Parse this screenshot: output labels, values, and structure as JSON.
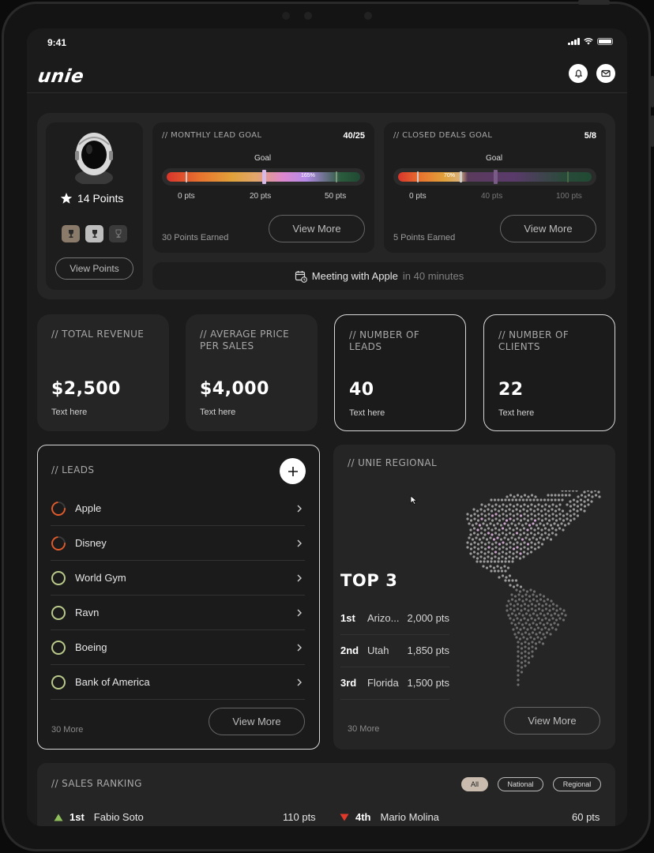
{
  "status": {
    "time": "9:41"
  },
  "brand": {
    "logo": "unie"
  },
  "header_icons": [
    "bell-icon",
    "mail-icon"
  ],
  "profile": {
    "points_label": "14 Points",
    "trophies": [
      "trophy-gold-icon",
      "trophy-silver-icon",
      "trophy-locked-icon"
    ],
    "button": "View Points"
  },
  "goals": [
    {
      "title": "// MONTHLY LEAD GOAL",
      "count": "40/25",
      "marker_label": "Goal",
      "percent_label": "165%",
      "progress": 1.65,
      "scale": [
        "0 pts",
        "20 pts",
        "50 pts"
      ],
      "earned": "30 Points Earned",
      "button": "View More"
    },
    {
      "title": "// CLOSED DEALS GOAL",
      "count": "5/8",
      "marker_label": "Goal",
      "percent_label": "70%",
      "progress": 0.7,
      "scale": [
        "0 pts",
        "40 pts",
        "100 pts"
      ],
      "earned": "5 Points Earned",
      "button": "View More"
    }
  ],
  "meeting": {
    "text": "Meeting with Apple",
    "time": "in 40 minutes"
  },
  "stats": [
    {
      "title": "// TOTAL REVENUE",
      "value": "$2,500",
      "sub": "Text here"
    },
    {
      "title": "// AVERAGE PRICE PER SALES",
      "value": "$4,000",
      "sub": "Text here"
    },
    {
      "title": "// NUMBER OF LEADS",
      "value": "40",
      "sub": "Text here"
    },
    {
      "title": "// NUMBER OF CLIENTS",
      "value": "22",
      "sub": "Text here"
    }
  ],
  "leads": {
    "title": "// LEADS",
    "items": [
      {
        "name": "Apple",
        "status": "in-progress"
      },
      {
        "name": "Disney",
        "status": "in-progress"
      },
      {
        "name": "World Gym",
        "status": "new"
      },
      {
        "name": "Ravn",
        "status": "new"
      },
      {
        "name": "Boeing",
        "status": "new"
      },
      {
        "name": "Bank of America",
        "status": "new"
      }
    ],
    "more": "30 More",
    "button": "View More"
  },
  "regional": {
    "title": "// UNIE REGIONAL",
    "heading": "TOP 3",
    "rows": [
      {
        "rank": "1st",
        "region": "Arizo...",
        "points": "2,000 pts"
      },
      {
        "rank": "2nd",
        "region": "Utah",
        "points": "1,850 pts"
      },
      {
        "rank": "3rd",
        "region": "Florida",
        "points": "1,500 pts"
      }
    ],
    "more": "30 More",
    "button": "View More"
  },
  "ranking": {
    "title": "// SALES RANKING",
    "filters": [
      "All",
      "National",
      "Regional"
    ],
    "active_filter": "All",
    "rows": [
      {
        "rank": "1st",
        "name": "Fabio Soto",
        "points": "110 pts",
        "trend": "up"
      },
      {
        "rank": "4th",
        "name": "Mario Molina",
        "points": "60 pts",
        "trend": "down"
      }
    ]
  },
  "colors": {
    "up": "#8fbf5a",
    "down": "#e0392b",
    "ring_progress": "#e05a2b",
    "ring_new": "#b9c98a"
  }
}
